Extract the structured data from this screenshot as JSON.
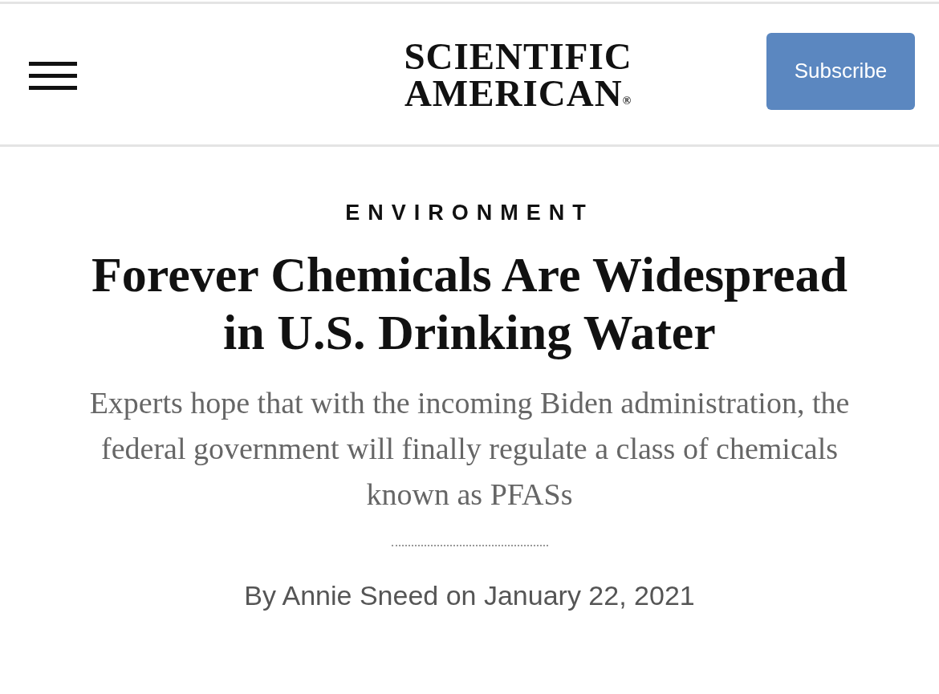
{
  "header": {
    "logo_lines": [
      "SCIENTIFIC",
      "AMERICAN"
    ],
    "logo_mark": "®",
    "subscribe_button": "Subscribe"
  },
  "article": {
    "section": "ENVIRONMENT",
    "title": "Forever Chemicals Are Widespread in U.S. Drinking Water",
    "subtitle": "Experts hope that with the incoming Biden administration, the federal government will finally regulate a class of chemicals known as PFASs",
    "byline": "By Annie Sneed on January 22, 2021"
  }
}
